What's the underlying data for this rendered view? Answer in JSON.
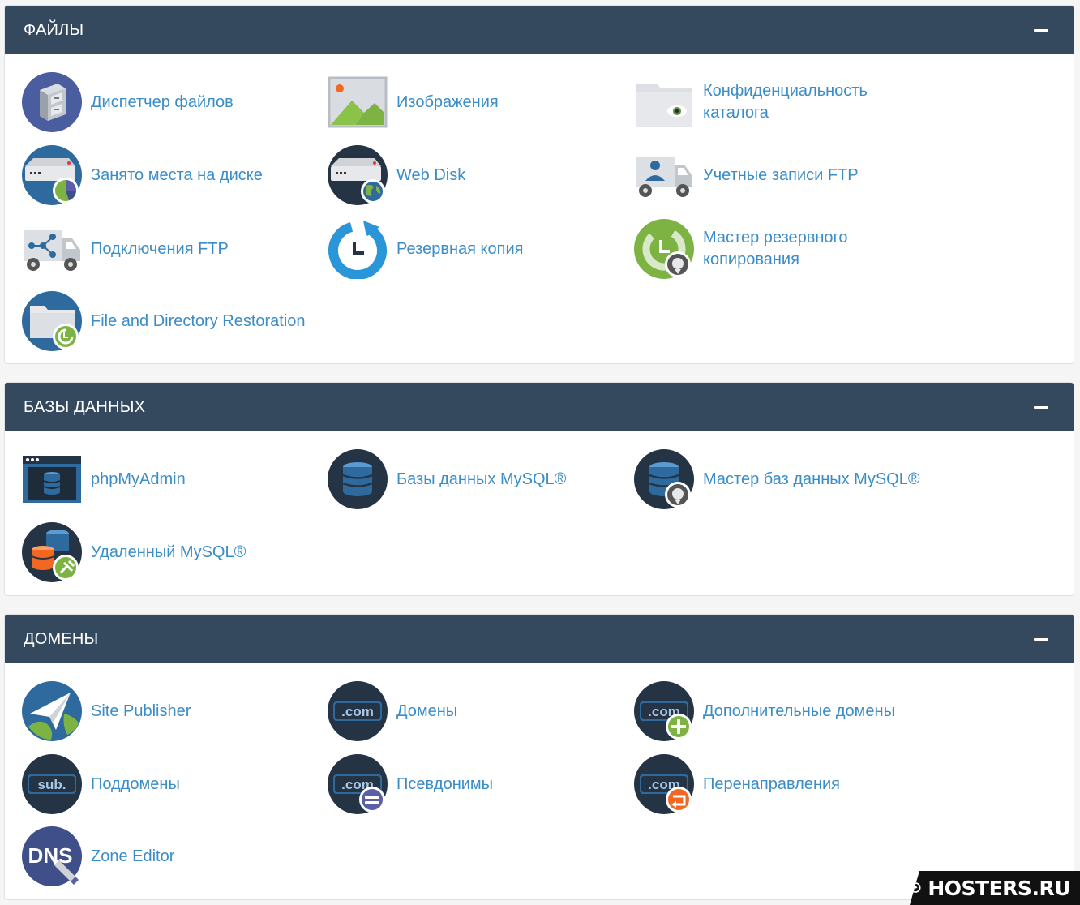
{
  "colors": {
    "header_bg": "#34495e",
    "link": "#3a8dc7",
    "page_bg": "#f5f5f5"
  },
  "sections": [
    {
      "title": "ФАЙЛЫ",
      "items": [
        {
          "label": "Диспетчер файлов",
          "icon": "file-cabinet-icon"
        },
        {
          "label": "Изображения",
          "icon": "image-icon"
        },
        {
          "label": "Конфиденциальность каталога",
          "icon": "folder-eye-icon"
        },
        {
          "label": "Занято места на диске",
          "icon": "disk-usage-icon"
        },
        {
          "label": "Web Disk",
          "icon": "web-disk-icon"
        },
        {
          "label": "Учетные записи FTP",
          "icon": "ftp-accounts-icon"
        },
        {
          "label": "Подключения FTP",
          "icon": "ftp-connections-icon"
        },
        {
          "label": "Резервная копия",
          "icon": "backup-icon"
        },
        {
          "label": "Мастер резервного копирования",
          "icon": "backup-wizard-icon"
        },
        {
          "label": "File and Directory Restoration",
          "icon": "file-restore-icon"
        }
      ]
    },
    {
      "title": "БАЗЫ ДАННЫХ",
      "items": [
        {
          "label": "phpMyAdmin",
          "icon": "phpmyadmin-icon"
        },
        {
          "label": "Базы данных MySQL®",
          "icon": "mysql-databases-icon"
        },
        {
          "label": "Мастер баз данных MySQL®",
          "icon": "mysql-wizard-icon"
        },
        {
          "label": "Удаленный MySQL®",
          "icon": "remote-mysql-icon"
        }
      ]
    },
    {
      "title": "ДОМЕНЫ",
      "items": [
        {
          "label": "Site Publisher",
          "icon": "site-publisher-icon"
        },
        {
          "label": "Домены",
          "icon": "domains-icon"
        },
        {
          "label": "Дополнительные домены",
          "icon": "addon-domains-icon"
        },
        {
          "label": "Поддомены",
          "icon": "subdomains-icon"
        },
        {
          "label": "Псевдонимы",
          "icon": "aliases-icon"
        },
        {
          "label": "Перенаправления",
          "icon": "redirects-icon"
        },
        {
          "label": "Zone Editor",
          "icon": "zone-editor-icon"
        }
      ]
    }
  ],
  "icon_text": {
    "com": ".com",
    "sub": "sub.",
    "dns": "DNS"
  },
  "watermark": {
    "text": "HOSTERS.RU",
    "icon": "chat-bubble-icon"
  }
}
